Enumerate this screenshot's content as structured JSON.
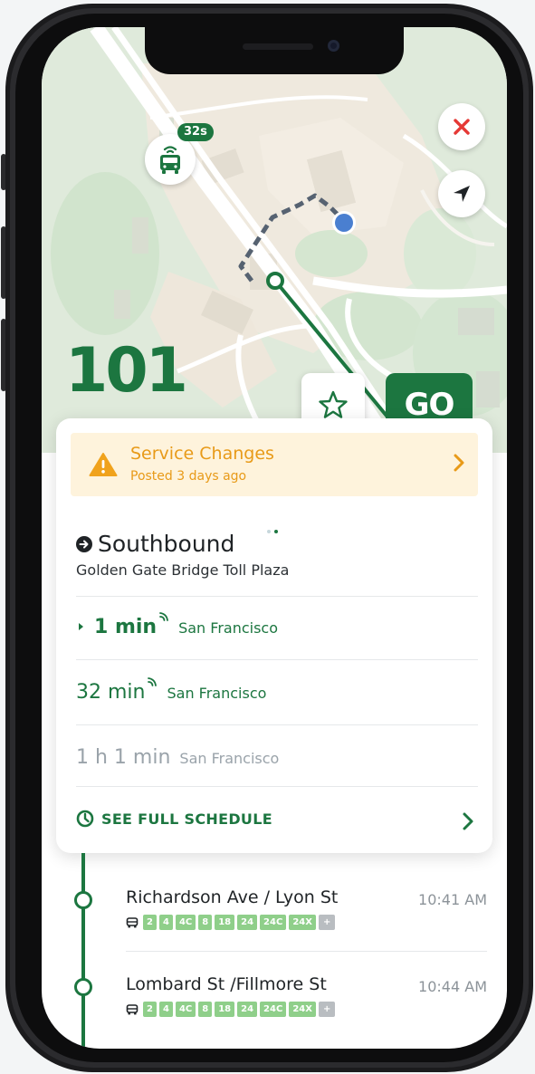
{
  "map": {
    "bus_eta_badge": "32s",
    "route_number": "101",
    "go_label": "GO"
  },
  "alert": {
    "title": "Service Changes",
    "subtitle": "Posted 3 days ago"
  },
  "direction": {
    "label": "Southbound",
    "stop": "Golden Gate Bridge Toll Plaza"
  },
  "arrivals": [
    {
      "time": "1 min",
      "dest": "San Francisco",
      "realtime": true,
      "color": "#1c7640"
    },
    {
      "time": "32 min",
      "dest": "San Francisco",
      "realtime": true,
      "color": "#1c7640"
    },
    {
      "time": "1 h 1 min",
      "dest": "San Francisco",
      "realtime": false,
      "color": "#9aa3aa"
    }
  ],
  "schedule_label": "SEE FULL SCHEDULE",
  "stops": [
    {
      "name": "Richardson Ave / Lyon St",
      "time": "10:41 AM",
      "routes": [
        "2",
        "4",
        "4C",
        "8",
        "18",
        "24",
        "24C",
        "24X"
      ],
      "more": "+"
    },
    {
      "name": "Lombard St /Fillmore St",
      "time": "10:44 AM",
      "routes": [
        "2",
        "4",
        "4C",
        "8",
        "18",
        "24",
        "24C",
        "24X"
      ],
      "more": "+"
    }
  ],
  "colors": {
    "brand_green": "#1c7640",
    "alert_amber": "#e89a18",
    "close_red": "#e53935",
    "user_location": "#4a7fd0"
  }
}
